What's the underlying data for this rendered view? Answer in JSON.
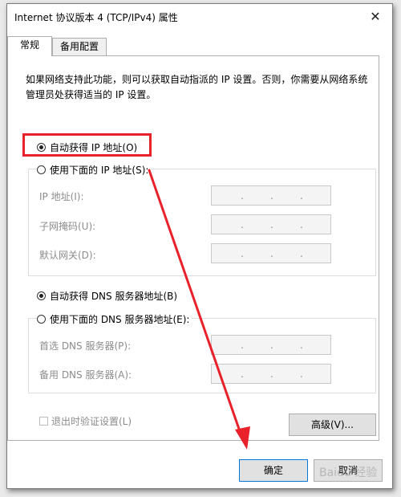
{
  "window": {
    "title": "Internet 协议版本 4 (TCP/IPv4) 属性",
    "close_glyph": "✕"
  },
  "tabs": [
    {
      "label": "常规",
      "active": true
    },
    {
      "label": "备用配置",
      "active": false
    }
  ],
  "description": "如果网络支持此功能，则可以获取自动指派的 IP 设置。否则，你需要从网络系统管理员处获得适当的 IP 设置。",
  "ip_section": {
    "auto_label": "自动获得 IP 地址(O)",
    "manual_label": "使用下面的 IP 地址(S):",
    "auto_selected": true,
    "fields": [
      {
        "label": "IP 地址(I):"
      },
      {
        "label": "子网掩码(U):"
      },
      {
        "label": "默认网关(D):"
      }
    ]
  },
  "dns_section": {
    "auto_label": "自动获得 DNS 服务器地址(B)",
    "manual_label": "使用下面的 DNS 服务器地址(E):",
    "auto_selected": true,
    "fields": [
      {
        "label": "首选 DNS 服务器(P):"
      },
      {
        "label": "备用 DNS 服务器(A):"
      }
    ]
  },
  "ip_separator": ".",
  "validate_label": "退出时验证设置(L)",
  "advanced_button": "高级(V)...",
  "ok_button": "确定",
  "cancel_button": "取消",
  "watermark": "Baidu 经验",
  "colors": {
    "highlight": "#e8212a",
    "arrow": "#e8212a",
    "ok_border": "#0078d7"
  }
}
